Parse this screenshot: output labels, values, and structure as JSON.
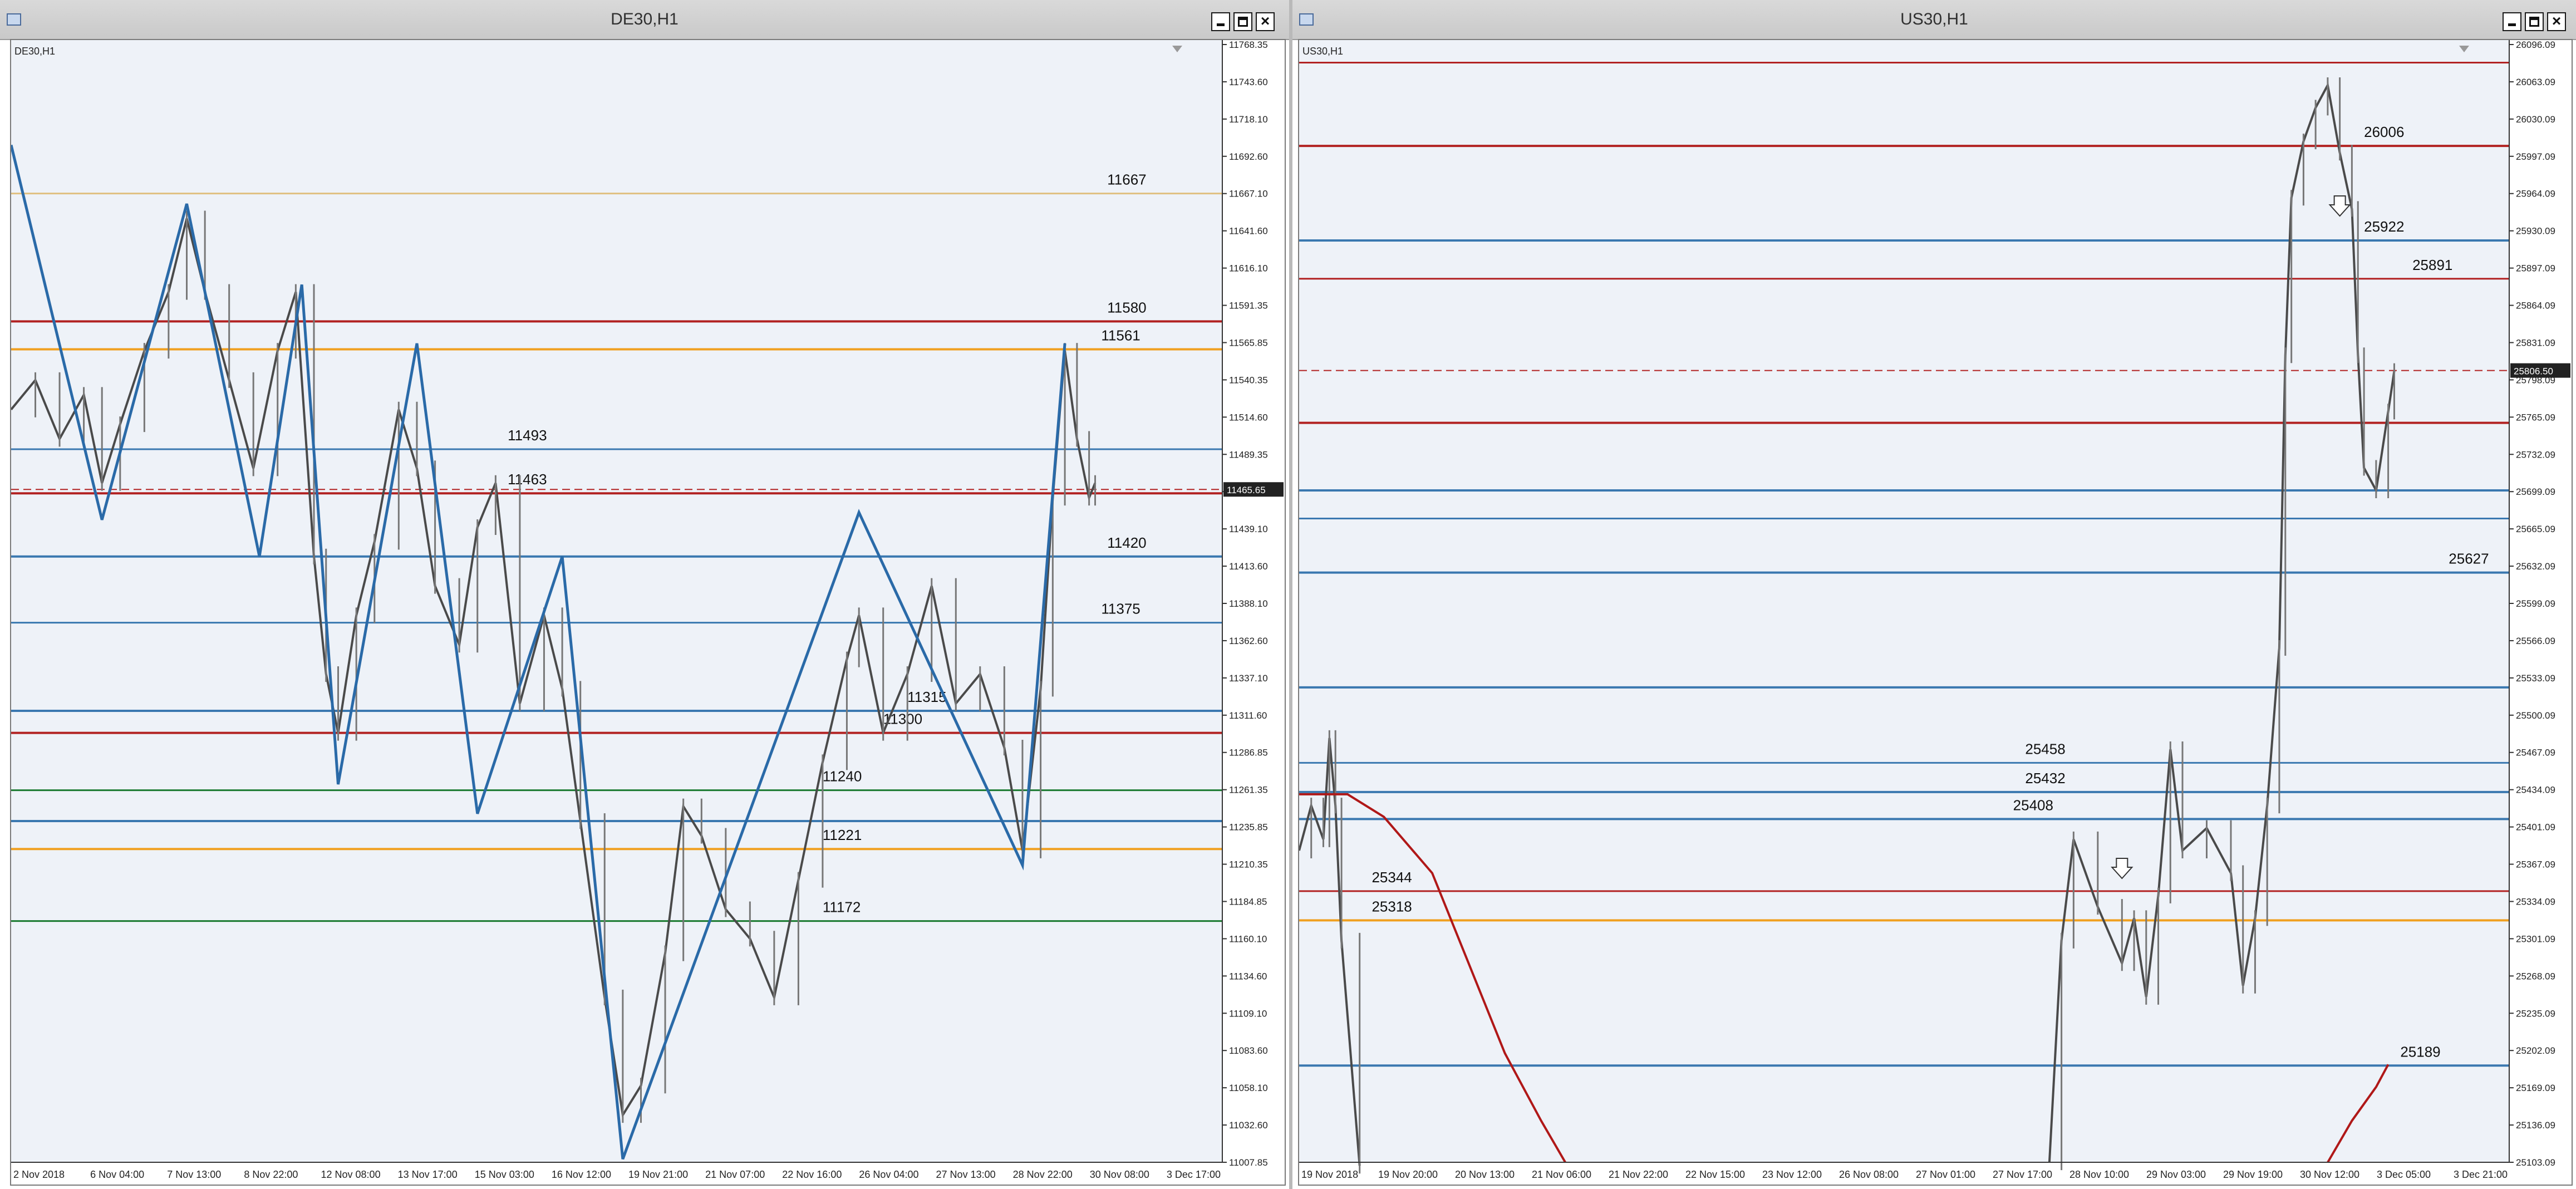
{
  "windows": [
    {
      "title": "DE30,H1",
      "symbol_label": "DE30,H1",
      "current_price": "11465.65",
      "chart_data": {
        "type": "line",
        "title": "DE30,H1",
        "ylim": [
          11007.85,
          11768.35
        ],
        "y_ticks": [
          "11768.35",
          "11743.60",
          "11718.10",
          "11692.60",
          "11667.10",
          "11641.60",
          "11616.10",
          "11591.35",
          "11565.85",
          "11540.35",
          "11514.60",
          "11489.35",
          "11465.65",
          "11439.10",
          "11413.60",
          "11388.10",
          "11362.60",
          "11337.10",
          "11311.60",
          "11286.85",
          "11261.35",
          "11235.85",
          "11210.35",
          "11184.85",
          "11160.10",
          "11134.60",
          "11109.10",
          "11083.60",
          "11058.10",
          "11032.60",
          "11007.85"
        ],
        "x_ticks": [
          "2 Nov 2018",
          "6 Nov 04:00",
          "7 Nov 13:00",
          "8 Nov 22:00",
          "12 Nov 08:00",
          "13 Nov 17:00",
          "15 Nov 03:00",
          "16 Nov 12:00",
          "19 Nov 21:00",
          "21 Nov 07:00",
          "22 Nov 16:00",
          "26 Nov 04:00",
          "27 Nov 13:00",
          "28 Nov 22:00",
          "30 Nov 08:00",
          "3 Dec 17:00"
        ],
        "levels": [
          {
            "value": 11667,
            "label": "11667",
            "color": "#e0c080"
          },
          {
            "value": 11580,
            "label": "11580",
            "color": "#b22222"
          },
          {
            "value": 11561,
            "label": "11561",
            "color": "#f0a020"
          },
          {
            "value": 11493,
            "label": "11493",
            "color": "#3a78b0"
          },
          {
            "value": 11463,
            "label": "11463",
            "color": "#b22222"
          },
          {
            "value": 11420,
            "label": "11420",
            "color": "#3a78b0"
          },
          {
            "value": 11375,
            "label": "11375",
            "color": "#3a78b0"
          },
          {
            "value": 11315,
            "label": "11315",
            "color": "#3a78b0"
          },
          {
            "value": 11300,
            "label": "11300",
            "color": "#b22222"
          },
          {
            "value": 11261,
            "label": "11240",
            "color": "#1a7a30"
          },
          {
            "value": 11240,
            "label": "",
            "color": "#3a78b0"
          },
          {
            "value": 11221,
            "label": "11221",
            "color": "#f0a020"
          },
          {
            "value": 11172,
            "label": "11172",
            "color": "#1a7a30"
          }
        ],
        "zigzag": [
          {
            "x": 0.0,
            "y": 11700
          },
          {
            "x": 0.075,
            "y": 11445
          },
          {
            "x": 0.145,
            "y": 11660
          },
          {
            "x": 0.205,
            "y": 11420
          },
          {
            "x": 0.24,
            "y": 11605
          },
          {
            "x": 0.27,
            "y": 11265
          },
          {
            "x": 0.335,
            "y": 11565
          },
          {
            "x": 0.385,
            "y": 11245
          },
          {
            "x": 0.455,
            "y": 11420
          },
          {
            "x": 0.505,
            "y": 11010
          },
          {
            "x": 0.7,
            "y": 11450
          },
          {
            "x": 0.835,
            "y": 11210
          },
          {
            "x": 0.87,
            "y": 11565
          }
        ],
        "price_path": [
          {
            "x": 0.0,
            "y": 11520
          },
          {
            "x": 0.02,
            "y": 11540
          },
          {
            "x": 0.04,
            "y": 11500
          },
          {
            "x": 0.06,
            "y": 11530
          },
          {
            "x": 0.075,
            "y": 11470
          },
          {
            "x": 0.09,
            "y": 11510
          },
          {
            "x": 0.11,
            "y": 11560
          },
          {
            "x": 0.13,
            "y": 11600
          },
          {
            "x": 0.145,
            "y": 11650
          },
          {
            "x": 0.16,
            "y": 11600
          },
          {
            "x": 0.18,
            "y": 11540
          },
          {
            "x": 0.2,
            "y": 11480
          },
          {
            "x": 0.22,
            "y": 11560
          },
          {
            "x": 0.235,
            "y": 11600
          },
          {
            "x": 0.25,
            "y": 11420
          },
          {
            "x": 0.26,
            "y": 11340
          },
          {
            "x": 0.27,
            "y": 11300
          },
          {
            "x": 0.285,
            "y": 11380
          },
          {
            "x": 0.3,
            "y": 11430
          },
          {
            "x": 0.32,
            "y": 11520
          },
          {
            "x": 0.335,
            "y": 11480
          },
          {
            "x": 0.35,
            "y": 11400
          },
          {
            "x": 0.37,
            "y": 11360
          },
          {
            "x": 0.385,
            "y": 11440
          },
          {
            "x": 0.4,
            "y": 11470
          },
          {
            "x": 0.42,
            "y": 11320
          },
          {
            "x": 0.44,
            "y": 11380
          },
          {
            "x": 0.455,
            "y": 11330
          },
          {
            "x": 0.47,
            "y": 11240
          },
          {
            "x": 0.49,
            "y": 11120
          },
          {
            "x": 0.505,
            "y": 11040
          },
          {
            "x": 0.52,
            "y": 11060
          },
          {
            "x": 0.54,
            "y": 11150
          },
          {
            "x": 0.555,
            "y": 11250
          },
          {
            "x": 0.57,
            "y": 11230
          },
          {
            "x": 0.59,
            "y": 11180
          },
          {
            "x": 0.61,
            "y": 11160
          },
          {
            "x": 0.63,
            "y": 11120
          },
          {
            "x": 0.65,
            "y": 11200
          },
          {
            "x": 0.67,
            "y": 11280
          },
          {
            "x": 0.69,
            "y": 11350
          },
          {
            "x": 0.7,
            "y": 11380
          },
          {
            "x": 0.72,
            "y": 11300
          },
          {
            "x": 0.74,
            "y": 11340
          },
          {
            "x": 0.76,
            "y": 11400
          },
          {
            "x": 0.78,
            "y": 11320
          },
          {
            "x": 0.8,
            "y": 11340
          },
          {
            "x": 0.82,
            "y": 11290
          },
          {
            "x": 0.835,
            "y": 11220
          },
          {
            "x": 0.85,
            "y": 11330
          },
          {
            "x": 0.86,
            "y": 11460
          },
          {
            "x": 0.87,
            "y": 11560
          },
          {
            "x": 0.88,
            "y": 11500
          },
          {
            "x": 0.89,
            "y": 11460
          },
          {
            "x": 0.895,
            "y": 11470
          }
        ]
      }
    },
    {
      "title": "US30,H1",
      "symbol_label": "US30,H1",
      "current_price": "25806.50",
      "chart_data": {
        "type": "line",
        "title": "US30,H1",
        "ylim": [
          25103.09,
          26096.09
        ],
        "y_ticks": [
          "26096.09",
          "26063.09",
          "26030.09",
          "25997.09",
          "25964.09",
          "25930.09",
          "25897.09",
          "25864.09",
          "25831.09",
          "25798.09",
          "25765.09",
          "25732.09",
          "25699.09",
          "25665.09",
          "25632.09",
          "25599.09",
          "25566.09",
          "25533.09",
          "25500.09",
          "25467.09",
          "25434.09",
          "25401.09",
          "25367.09",
          "25334.09",
          "25301.09",
          "25268.09",
          "25235.09",
          "25202.09",
          "25169.09",
          "25136.09",
          "25103.09"
        ],
        "x_ticks": [
          "19 Nov 2018",
          "19 Nov 20:00",
          "20 Nov 13:00",
          "21 Nov 06:00",
          "21 Nov 22:00",
          "22 Nov 15:00",
          "23 Nov 12:00",
          "26 Nov 08:00",
          "27 Nov 01:00",
          "27 Nov 17:00",
          "28 Nov 10:00",
          "29 Nov 03:00",
          "29 Nov 19:00",
          "30 Nov 12:00",
          "3 Dec 05:00",
          "3 Dec 21:00"
        ],
        "levels": [
          {
            "value": 26080,
            "label": "",
            "color": "#b22222"
          },
          {
            "value": 26006,
            "label": "26006",
            "color": "#b22222"
          },
          {
            "value": 25922,
            "label": "25922",
            "color": "#3a78b0"
          },
          {
            "value": 25888,
            "label": "25891",
            "color": "#b22222"
          },
          {
            "value": 25760,
            "label": "",
            "color": "#b22222"
          },
          {
            "value": 25700,
            "label": "",
            "color": "#3a78b0"
          },
          {
            "value": 25675,
            "label": "",
            "color": "#3a78b0"
          },
          {
            "value": 25627,
            "label": "25627",
            "color": "#3a78b0"
          },
          {
            "value": 25525,
            "label": "",
            "color": "#3a78b0"
          },
          {
            "value": 25458,
            "label": "25458",
            "color": "#3a78b0"
          },
          {
            "value": 25432,
            "label": "25432",
            "color": "#3a78b0"
          },
          {
            "value": 25408,
            "label": "25408",
            "color": "#3a78b0"
          },
          {
            "value": 25344,
            "label": "25344",
            "color": "#b22222"
          },
          {
            "value": 25318,
            "label": "25318",
            "color": "#f0a020"
          },
          {
            "value": 25189,
            "label": "25189",
            "color": "#3a78b0"
          }
        ],
        "price_segments": [
          [
            {
              "x": 0.0,
              "y": 25380
            },
            {
              "x": 0.01,
              "y": 25420
            },
            {
              "x": 0.02,
              "y": 25390
            },
            {
              "x": 0.025,
              "y": 25480
            },
            {
              "x": 0.03,
              "y": 25420
            },
            {
              "x": 0.035,
              "y": 25300
            },
            {
              "x": 0.05,
              "y": 25100
            }
          ],
          [
            {
              "x": 0.62,
              "y": 25103
            },
            {
              "x": 0.63,
              "y": 25300
            },
            {
              "x": 0.64,
              "y": 25390
            },
            {
              "x": 0.66,
              "y": 25330
            },
            {
              "x": 0.68,
              "y": 25280
            },
            {
              "x": 0.69,
              "y": 25320
            },
            {
              "x": 0.7,
              "y": 25250
            },
            {
              "x": 0.71,
              "y": 25340
            },
            {
              "x": 0.72,
              "y": 25470
            },
            {
              "x": 0.73,
              "y": 25380
            },
            {
              "x": 0.75,
              "y": 25400
            },
            {
              "x": 0.77,
              "y": 25360
            },
            {
              "x": 0.78,
              "y": 25260
            },
            {
              "x": 0.79,
              "y": 25320
            },
            {
              "x": 0.8,
              "y": 25420
            },
            {
              "x": 0.81,
              "y": 25560
            },
            {
              "x": 0.815,
              "y": 25820
            },
            {
              "x": 0.82,
              "y": 25960
            },
            {
              "x": 0.83,
              "y": 26010
            },
            {
              "x": 0.84,
              "y": 26040
            },
            {
              "x": 0.85,
              "y": 26060
            },
            {
              "x": 0.86,
              "y": 26000
            },
            {
              "x": 0.87,
              "y": 25950
            },
            {
              "x": 0.875,
              "y": 25820
            },
            {
              "x": 0.88,
              "y": 25720
            },
            {
              "x": 0.89,
              "y": 25700
            },
            {
              "x": 0.9,
              "y": 25770
            },
            {
              "x": 0.905,
              "y": 25806
            }
          ]
        ],
        "ma_curve": [
          {
            "x": 0.0,
            "y": 25430
          },
          {
            "x": 0.04,
            "y": 25430
          },
          {
            "x": 0.07,
            "y": 25410
          },
          {
            "x": 0.11,
            "y": 25360
          },
          {
            "x": 0.14,
            "y": 25280
          },
          {
            "x": 0.17,
            "y": 25200
          },
          {
            "x": 0.2,
            "y": 25140
          },
          {
            "x": 0.22,
            "y": 25103
          }
        ],
        "ma_curve_2": [
          {
            "x": 0.85,
            "y": 25103
          },
          {
            "x": 0.87,
            "y": 25140
          },
          {
            "x": 0.89,
            "y": 25170
          },
          {
            "x": 0.9,
            "y": 25190
          }
        ]
      }
    }
  ]
}
